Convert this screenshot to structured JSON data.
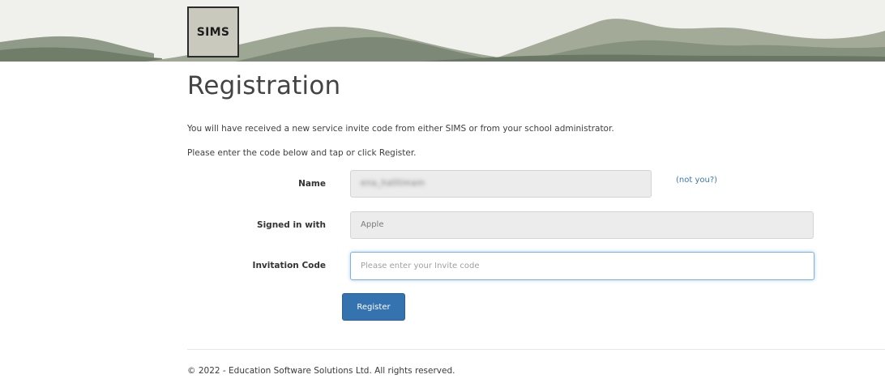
{
  "header": {
    "logo_text": "SIMS"
  },
  "page": {
    "title": "Registration",
    "intro_line_1": "You will have received a new service invite code from either SIMS or from your school administrator.",
    "intro_line_2": "Please enter the code below and tap or click Register."
  },
  "form": {
    "name": {
      "label": "Name",
      "value": "ena_halllimam",
      "not_you_link": "(not you?)"
    },
    "signed_in_with": {
      "label": "Signed in with",
      "value": "Apple"
    },
    "invitation_code": {
      "label": "Invitation Code",
      "value": "",
      "placeholder": "Please enter your Invite code"
    },
    "register_button": "Register"
  },
  "footer": {
    "copyright": "© 2022 - Education Software Solutions Ltd. All rights reserved."
  },
  "colors": {
    "primary_button": "#3572b0",
    "link": "#3a78b8",
    "input_focus_border": "#7fb2e3",
    "readonly_field_bg": "#ececec"
  }
}
